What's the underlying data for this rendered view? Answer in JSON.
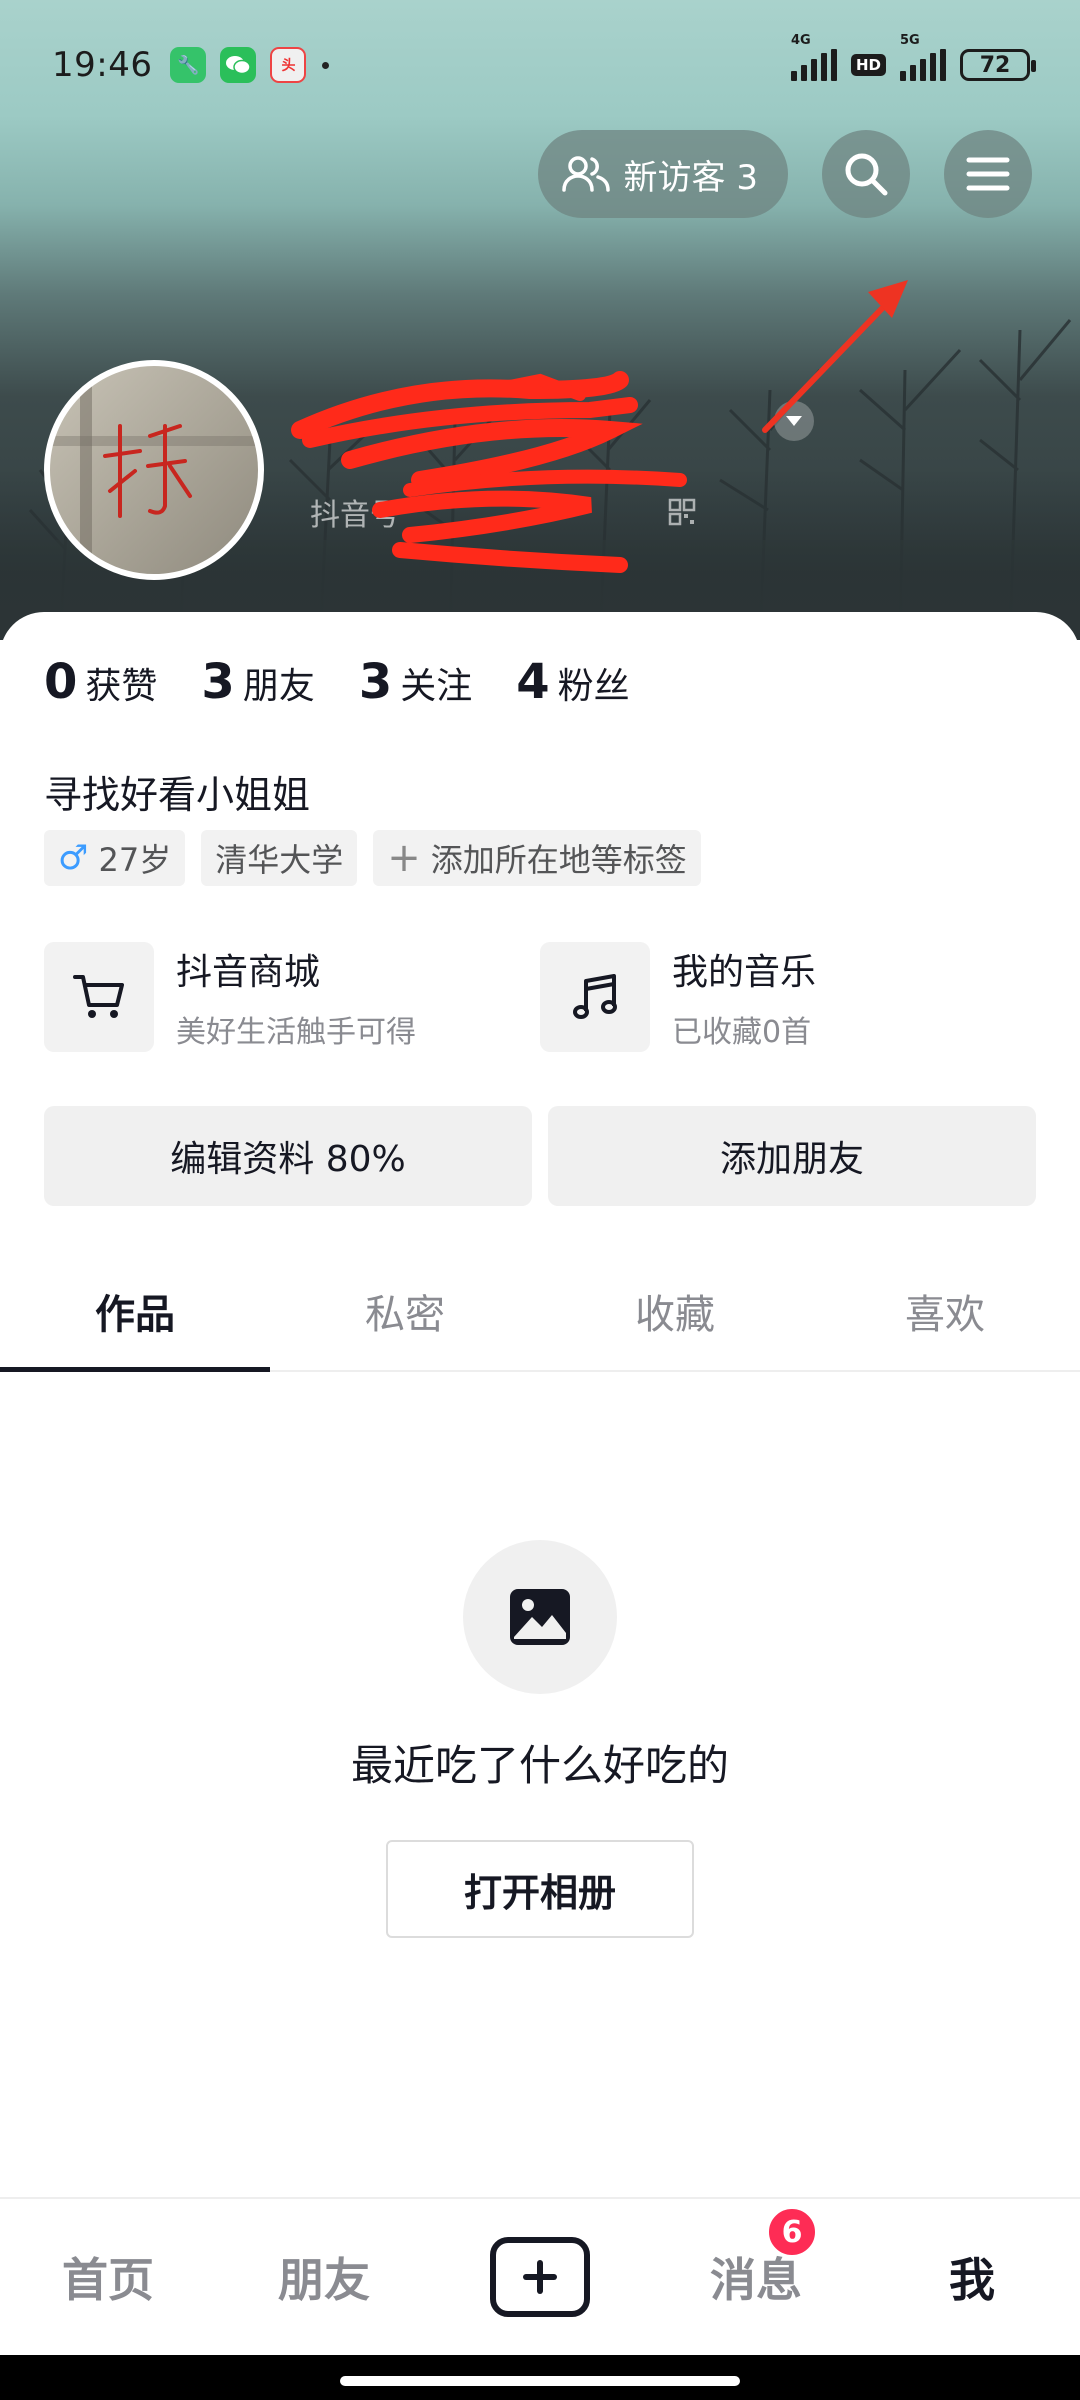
{
  "status_bar": {
    "time": "19:46",
    "network_1": "4G",
    "hd": "HD",
    "network_2": "5G",
    "battery": "72",
    "apps": [
      "tools-app-icon",
      "wechat-icon",
      "toutiao-icon"
    ]
  },
  "header": {
    "visitor_label": "新访客 3",
    "profile_name": "",
    "douyin_id_prefix": "抖音号",
    "annotations": {
      "scribble_color": "#ff2a1a",
      "arrow_color": "#ee3322"
    }
  },
  "stats": [
    {
      "num": "0",
      "label": "获赞"
    },
    {
      "num": "3",
      "label": "朋友"
    },
    {
      "num": "3",
      "label": "关注"
    },
    {
      "num": "4",
      "label": "粉丝"
    }
  ],
  "bio": "寻找好看小姐姐",
  "tags": {
    "age": "27岁",
    "school": "清华大学",
    "add": "添加所在地等标签"
  },
  "features": {
    "mall": {
      "title": "抖音商城",
      "subtitle": "美好生活触手可得"
    },
    "music": {
      "title": "我的音乐",
      "subtitle": "已收藏0首"
    }
  },
  "actions": {
    "edit": "编辑资料 80%",
    "add_friend": "添加朋友"
  },
  "tabs": [
    "作品",
    "私密",
    "收藏",
    "喜欢"
  ],
  "empty": {
    "text": "最近吃了什么好吃的",
    "button": "打开相册"
  },
  "bottom_nav": {
    "home": "首页",
    "friends": "朋友",
    "messages": "消息",
    "messages_badge": "6",
    "me": "我"
  },
  "colors": {
    "accent_red": "#fe2c55",
    "text": "#161823",
    "muted": "#8a8b91"
  }
}
